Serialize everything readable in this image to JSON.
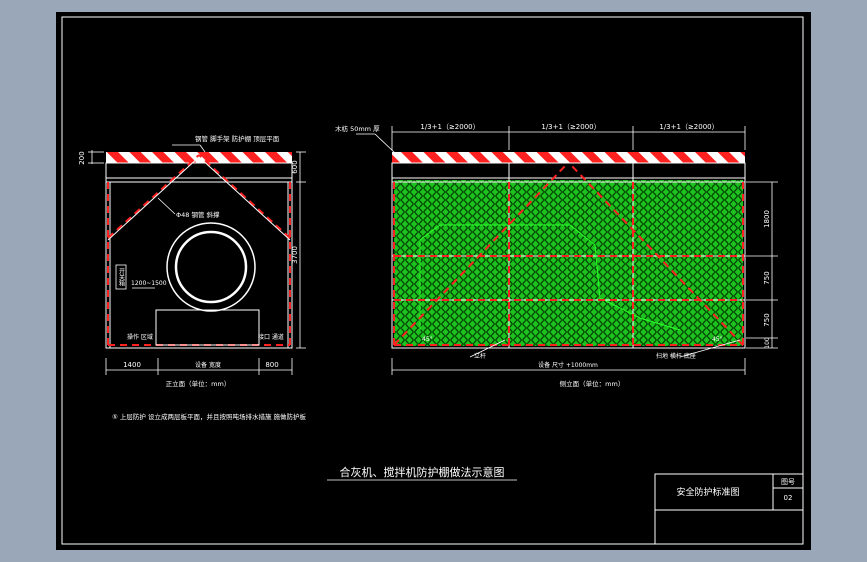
{
  "drawing_title": "合灰机、搅拌机防护棚做法示意图",
  "title_block": {
    "name": "安全防护标准图",
    "sheet_label": "图号",
    "sheet_number": "02"
  },
  "note": "⑤ 上层防护 设立成两层板平面，并且按照吨场排水措施 施做防护板",
  "front_view": {
    "caption": "正立面（单位：mm）",
    "top_callout": "钢管 脚手架 防护棚 顶层平面",
    "diag_callout": "Φ48 钢管 斜撑",
    "dims": {
      "roof": "200",
      "roof_gap": "600",
      "height": "3700",
      "left": "1400",
      "right": "800"
    },
    "side_note": "开关箱",
    "range": "1200~1500",
    "label_left": "操作 区域",
    "label_right": "接口 通道",
    "label_bottom": "设备 宽度"
  },
  "side_view": {
    "caption": "侧立面（单位：mm）",
    "top_callout": "木枋 50mm 厚",
    "bays": [
      "1/3+1（≥2000）",
      "1/3+1（≥2000）",
      "1/3+1（≥2000）"
    ],
    "right_dims": [
      "1800",
      "750",
      "750",
      "100"
    ],
    "angle": "45°",
    "bottom_left": "立杆",
    "bottom_mid": "设备 尺寸 +1000mm",
    "bottom_right": "扫地 横杆 底座"
  },
  "colors": {
    "frame": "#ffffff",
    "hazard_red": "#ff2020",
    "mesh_green": "#1ec21e",
    "paper": "#000000"
  }
}
